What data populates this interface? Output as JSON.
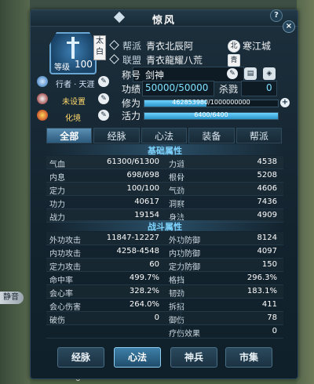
{
  "window": {
    "title": "惊风",
    "help_label": "?",
    "close_label": "×"
  },
  "character": {
    "level_label": "等级",
    "level": "100",
    "rank_badge": "太白"
  },
  "side": {
    "path_title": "行者 · 天涯",
    "unset_label": "未设置",
    "transform_label": "化境"
  },
  "info": {
    "faction_label": "帮派",
    "faction_value": "青衣北辰阿",
    "faction_badge": "北",
    "city": "寒江城",
    "alliance_label": "联盟",
    "alliance_value": "青衣龍耀八荒",
    "alliance_badge": "青",
    "title_label": "称号",
    "title_value": "剑神",
    "merit_label": "功绩",
    "merit_value": "50000/50000",
    "kills_label": "杀戮",
    "kills_value": "0"
  },
  "bars": {
    "cultivation_label": "修为",
    "cultivation_text": "462853980/1000000000",
    "cultivation_fraction": 0.4629,
    "vitality_label": "活力",
    "vitality_text": "6400/6400",
    "vitality_fraction": 1.0
  },
  "tabs": [
    "全部",
    "经脉",
    "心法",
    "装备",
    "帮派"
  ],
  "basic": {
    "title": "基础属性",
    "rows": [
      {
        "l": "气血",
        "v": "61300/61300",
        "l2": "力道",
        "v2": "4538"
      },
      {
        "l": "内息",
        "v": "698/698",
        "l2": "根骨",
        "v2": "5208"
      },
      {
        "l": "定力",
        "v": "100/100",
        "l2": "气劲",
        "v2": "4606"
      },
      {
        "l": "功力",
        "v": "40617",
        "l2": "洞察",
        "v2": "7436"
      },
      {
        "l": "战力",
        "v": "19154",
        "l2": "身法",
        "v2": "4909"
      }
    ]
  },
  "combat": {
    "title": "战斗属性",
    "rows": [
      {
        "l": "外功攻击",
        "v": "11847-12227",
        "l2": "外功防御",
        "v2": "8124"
      },
      {
        "l": "内功攻击",
        "v": "4258-4548",
        "l2": "内功防御",
        "v2": "4097"
      },
      {
        "l": "定力攻击",
        "v": "60",
        "l2": "定力防御",
        "v2": "150"
      },
      {
        "l": "命中率",
        "v": "499.7%",
        "l2": "格挡",
        "v2": "296.3%"
      },
      {
        "l": "会心率",
        "v": "328.2%",
        "l2": "韧劲",
        "v2": "183.1%"
      },
      {
        "l": "会心伤害",
        "v": "264.0%",
        "l2": "拆招",
        "v2": "411"
      },
      {
        "l": "破伤",
        "v": "0",
        "l2": "御伤",
        "v2": "78"
      },
      {
        "l": "",
        "v": "",
        "l2": "疗伤效果",
        "v2": "0"
      }
    ]
  },
  "bottom_buttons": [
    "经脉",
    "心法",
    "神兵",
    "市集"
  ],
  "outside": {
    "side_tag": "静音",
    "bottom_char": "6"
  }
}
